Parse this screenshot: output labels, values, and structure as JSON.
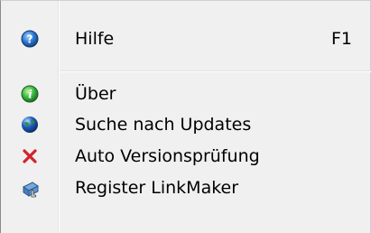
{
  "menu": {
    "items": [
      {
        "label": "Hilfe",
        "shortcut": "F1",
        "icon": "help-icon"
      },
      {
        "label": "Über",
        "icon": "info-icon"
      },
      {
        "label": "Suche nach Updates",
        "icon": "globe-icon"
      },
      {
        "label": "Auto Versionsprüfung",
        "icon": "red-x-icon"
      },
      {
        "label": "Register LinkMaker",
        "icon": "register-icon"
      }
    ]
  },
  "colors": {
    "menu_background": "#f0f0f0",
    "help_icon_blue": "#2f79d4",
    "info_icon_green": "#3cb843",
    "globe_blue": "#1f5fbf",
    "x_red": "#d3232a"
  }
}
